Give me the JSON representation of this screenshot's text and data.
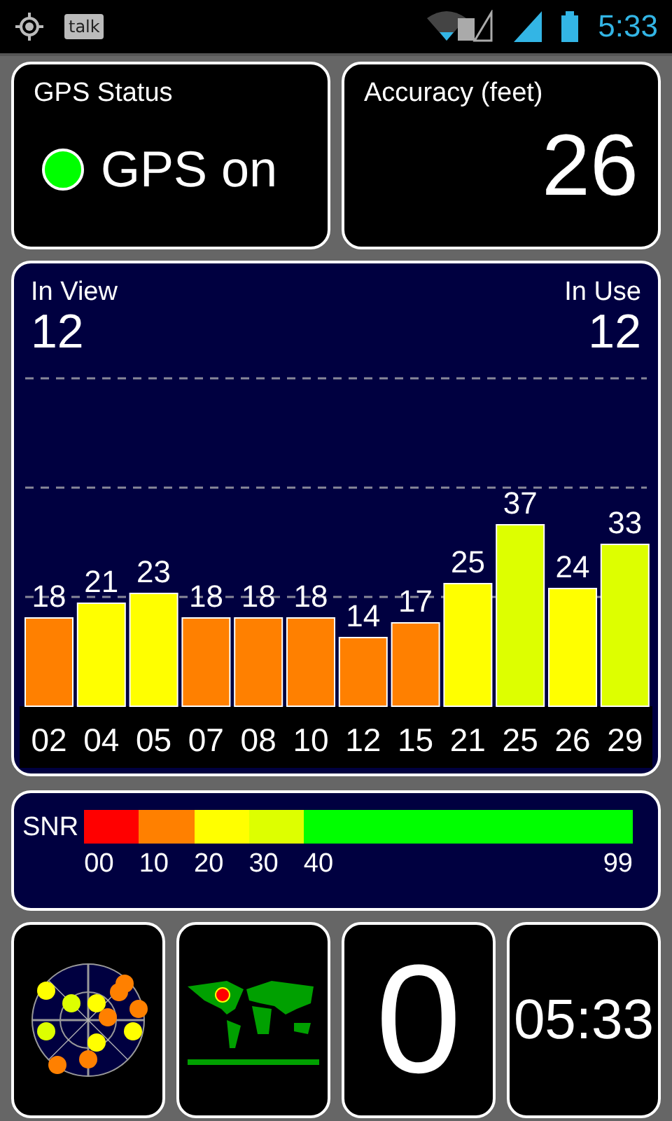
{
  "status_bar": {
    "notification_label": "talk",
    "time": "5:33"
  },
  "gps_status": {
    "title": "GPS Status",
    "on": true,
    "text": "GPS on"
  },
  "accuracy": {
    "title": "Accuracy (feet)",
    "value": "26"
  },
  "satellites": {
    "in_view_label": "In View",
    "in_view": "12",
    "in_use_label": "In Use",
    "in_use": "12",
    "chart_data": {
      "type": "bar",
      "categories": [
        "02",
        "04",
        "05",
        "07",
        "08",
        "10",
        "12",
        "15",
        "21",
        "25",
        "26",
        "29"
      ],
      "values": [
        18,
        21,
        23,
        18,
        18,
        18,
        14,
        17,
        25,
        37,
        24,
        33
      ],
      "data_labels": true
    }
  },
  "snr_legend": {
    "label": "SNR",
    "segments": [
      {
        "label": "00",
        "color": "#ff0000"
      },
      {
        "label": "10",
        "color": "#ff8000"
      },
      {
        "label": "20",
        "color": "#ffff00"
      },
      {
        "label": "30",
        "color": "#ddff00"
      },
      {
        "label": "40",
        "color": "#00ff00"
      }
    ],
    "end_label": "99"
  },
  "tiles": {
    "satellite_count": "0",
    "clock": "05:33"
  }
}
